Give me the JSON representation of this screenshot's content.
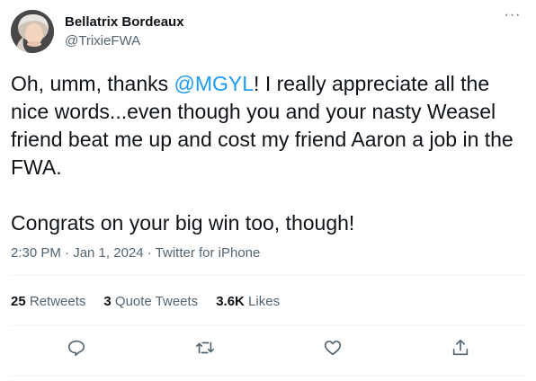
{
  "author": {
    "name": "Bellatrix Bordeaux",
    "handle": "@TrixieFWA",
    "avatar_icon": "profile-photo"
  },
  "tweet": {
    "text_before_mention": "Oh, umm, thanks ",
    "mention": "@MGYL",
    "text_after_mention": "! I really appreciate all the nice words...even though you and your nasty Weasel friend beat me up and cost my friend Aaron a job in the FWA.\n\nCongrats on your big win too, though!",
    "timestamp": "2:30 PM · Jan 1, 2024 · Twitter for iPhone"
  },
  "stats": {
    "retweets_count": "25",
    "retweets_label": "Retweets",
    "quotes_count": "3",
    "quotes_label": "Quote Tweets",
    "likes_count": "3.6K",
    "likes_label": "Likes"
  },
  "actions": {
    "reply_icon": "reply-icon",
    "retweet_icon": "retweet-icon",
    "like_icon": "heart-icon",
    "share_icon": "share-icon"
  },
  "colors": {
    "mention": "#1d9bf0",
    "secondary_text": "#536471",
    "divider": "#eff3f4"
  }
}
